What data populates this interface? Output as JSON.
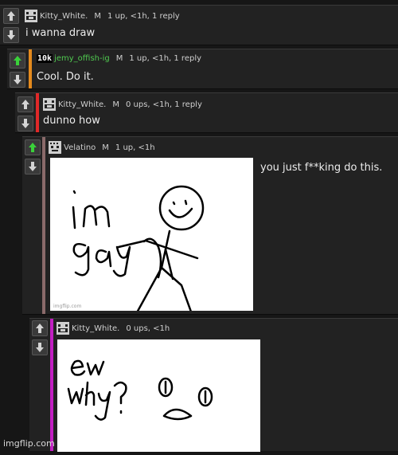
{
  "colors": {
    "upvote_active": "#3ad13a",
    "vote_default": "#d4d4d4",
    "bar_level1": "#e48a1d",
    "bar_level2": "#e02828",
    "bar_level3": "#8a6a6a",
    "bar_level4": "#c21fc2",
    "highlight_user": "#4fc94f"
  },
  "comments": [
    {
      "user": "Kitty_White.",
      "mod": "M",
      "stats": "1 up, <1h, 1 reply",
      "text": "i wanna draw",
      "upvoted": false
    },
    {
      "rank": "10k",
      "user": "jemy_offish-ig",
      "mod": "M",
      "stats": "1 up, <1h, 1 reply",
      "text": "Cool. Do it.",
      "upvoted": true
    },
    {
      "user": "Kitty_White.",
      "mod": "M",
      "stats": "0 ups, <1h, 1 reply",
      "text": "dunno how",
      "upvoted": false
    },
    {
      "user": "Velatino",
      "mod": "M",
      "stats": "1 up, <1h",
      "text": "you just f**king do this.",
      "image_text": "im gay",
      "upvoted": true
    },
    {
      "user": "Kitty_White.",
      "stats": "0 ups, <1h",
      "image_text": "ew why?",
      "upvoted": false
    }
  ],
  "watermark": "imgflip.com"
}
